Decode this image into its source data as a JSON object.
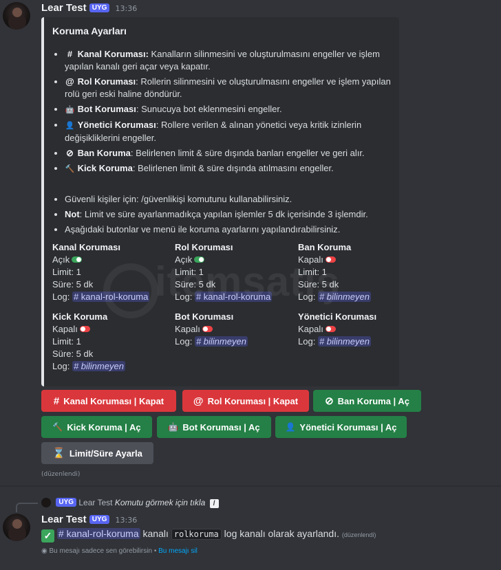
{
  "msg1": {
    "username": "Lear Test",
    "badge": "UYG",
    "timestamp": "13:36",
    "embed": {
      "title": "Koruma Ayarları",
      "features": [
        {
          "icon": "#",
          "title": "Kanal Koruması:",
          "text": " Kanalların silinmesini ve oluşturulmasını engeller ve işlem yapılan kanalı geri açar veya kapatır."
        },
        {
          "icon": "@",
          "title": "Rol Koruması",
          "text": ": Rollerin silinmesini ve oluşturulmasını engeller ve işlem yapılan rolü geri eski haline döndürür."
        },
        {
          "icon": "🤖",
          "title": "Bot Koruması",
          "text": ": Sunucuya bot eklenmesini engeller."
        },
        {
          "icon": "👤",
          "title": "Yönetici Koruması",
          "text": ": Rollere verilen & alınan yönetici veya kritik izinlerin değişikliklerini engeller."
        },
        {
          "icon": "⊘",
          "title": "Ban Koruma",
          "text": ": Belirlenen limit & süre dışında banları engeller ve geri alır."
        },
        {
          "icon": "🔨",
          "title": "Kick Koruma",
          "text": ": Belirlenen limit & süre dışında atılmasını engeller."
        }
      ],
      "notes": {
        "n1": "Güvenli kişiler için: /güvenlikişi komutunu kullanabilirsiniz.",
        "n2_bold": "Not",
        "n2": ": Limit ve süre ayarlanmadıkça yapılan işlemler 5 dk içerisinde 3 işlemdir.",
        "n3": "Aşağıdaki butonlar ve menü ile koruma ayarlarını yapılandırabilirsiniz."
      },
      "fields": {
        "kanal": {
          "name": "Kanal Koruması",
          "status": "Açık",
          "limit": "Limit: 1",
          "sure": "Süre: 5 dk",
          "log_label": "Log:",
          "log": "# kanal-rol-koruma"
        },
        "rol": {
          "name": "Rol Koruması",
          "status": "Açık",
          "limit": "Limit: 1",
          "sure": "Süre: 5 dk",
          "log_label": "Log:",
          "log": "# kanal-rol-koruma"
        },
        "ban": {
          "name": "Ban Koruma",
          "status": "Kapalı",
          "limit": "Limit: 1",
          "sure": "Süre: 5 dk",
          "log_label": "Log:",
          "log": "# bilinmeyen"
        },
        "kick": {
          "name": "Kick Koruma",
          "status": "Kapalı",
          "limit": "Limit: 1",
          "sure": "Süre: 5 dk",
          "log_label": "Log:",
          "log": "# bilinmeyen"
        },
        "bot": {
          "name": "Bot Koruması",
          "status": "Kapalı",
          "log_label": "Log:",
          "log": "# bilinmeyen"
        },
        "yonetici": {
          "name": "Yönetici Koruması",
          "status": "Kapalı",
          "log_label": "Log:",
          "log": "# bilinmeyen"
        }
      }
    },
    "buttons": {
      "kanal": {
        "icon": "#",
        "label": "Kanal Koruması | Kapat"
      },
      "rol": {
        "icon": "@",
        "label": "Rol Koruması | Kapat"
      },
      "ban": {
        "icon": "⊘",
        "label": "Ban Koruma | Aç"
      },
      "kick": {
        "icon": "🔨",
        "label": "Kick Koruma | Aç"
      },
      "bot": {
        "icon": "🤖",
        "label": "Bot Koruması | Aç"
      },
      "yonetici": {
        "icon": "👤",
        "label": "Yönetici Koruması | Aç"
      },
      "limit": {
        "icon": "⌛",
        "label": "Limit/Süre Ayarla"
      }
    },
    "edited": "(düzenlendi)"
  },
  "watermark": "itemsatış",
  "msg2": {
    "reply": {
      "badge": "UYG",
      "user": "Lear Test",
      "text": "Komutu görmek için tıkla"
    },
    "username": "Lear Test",
    "badge": "UYG",
    "timestamp": "13:36",
    "channel": "# kanal-rol-koruma",
    "text1": " kanalı ",
    "code": "rolkoruma",
    "text2": " log kanalı olarak ayarlandı.",
    "edited": "(düzenlendi)",
    "ephemeral": "Bu mesajı sadece sen görebilirsin • ",
    "delete_link": "Bu mesajı sil"
  },
  "colors": {
    "blurple": "#5865f2",
    "red_button": "#da373c",
    "green_button": "#248046",
    "gray_button": "#4e5058",
    "background": "#313338",
    "embed": "#2b2d31"
  }
}
